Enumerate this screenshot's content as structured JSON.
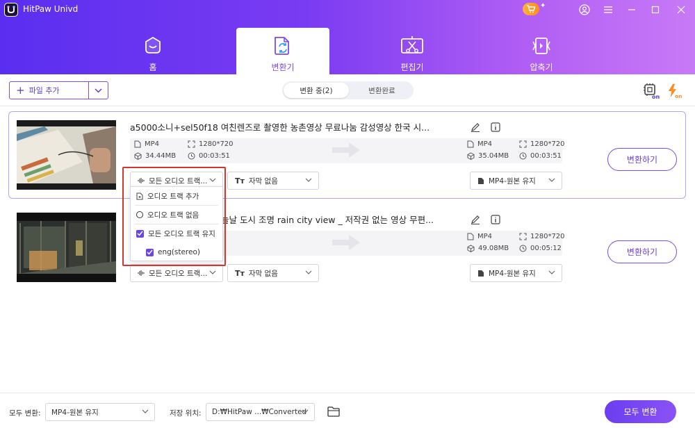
{
  "app": {
    "title": "HitPaw Univd"
  },
  "nav": {
    "tabs": [
      {
        "label": "홈",
        "icon": "home-icon"
      },
      {
        "label": "변환기",
        "icon": "converter-icon",
        "active": true
      },
      {
        "label": "편집기",
        "icon": "editor-icon"
      },
      {
        "label": "압축기",
        "icon": "compressor-icon"
      }
    ]
  },
  "toolbar": {
    "add_file_label": "파일 추가",
    "segments": [
      "변환 중(2)",
      "변환완료"
    ],
    "hw_accel_badge": "on",
    "lightning_badge": "on"
  },
  "files": [
    {
      "name": "a5000소니+sel50f18 여친렌즈로 촬영한 농촌영상 무료나눔 감성영상 한국 시...",
      "src": {
        "format": "MP4",
        "resolution": "1280*720",
        "size": "34.44MB",
        "duration": "00:03:51"
      },
      "out": {
        "format": "MP4",
        "resolution": "1280*720",
        "size": "35.04MB",
        "duration": "00:03:51"
      },
      "audio_select": "모든 오디오 트랙...",
      "subtitle_select": "자막 없음",
      "output_select": "MP4-원본 유지",
      "convert_label": "변환하기"
    },
    {
      "name": "늘날 도시 조명 rain city view _ 저작권 없는 영상 무편...",
      "out": {
        "format": "MP4",
        "resolution": "1280*720",
        "size": "49.08MB",
        "duration": "00:05:12"
      },
      "audio_select": "모든 오디오 트랙...",
      "subtitle_select": "자막 없음",
      "output_select": "MP4-원본 유지",
      "convert_label": "변환하기"
    }
  ],
  "audio_menu": {
    "add_track": "오디오 트랙 추가",
    "no_track": "오디오 트랙 없음",
    "keep_all": "모든 오디오 트랙 유지",
    "track_eng": "eng(stereo)"
  },
  "footer": {
    "convert_all_label": "모두 변환:",
    "convert_all_value": "MP4-원본 유지",
    "save_label": "저장 위치:",
    "save_value": "D:₩HitPaw ...₩Converted",
    "all_button": "모두 변환"
  },
  "colors": {
    "accent": "#7b4bf4",
    "highlight": "#d8342e"
  }
}
